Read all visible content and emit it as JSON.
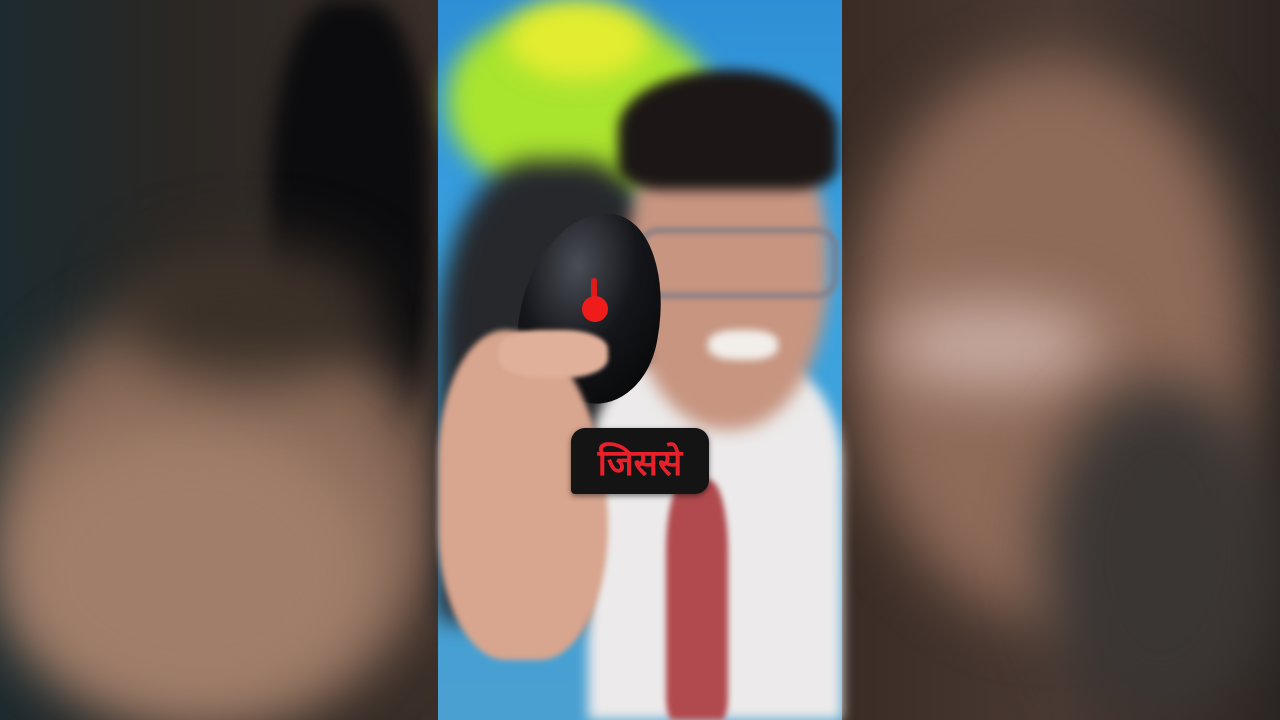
{
  "video": {
    "caption": "जिससे",
    "caption_color": "#e8202a",
    "caption_bg": "#141414"
  }
}
